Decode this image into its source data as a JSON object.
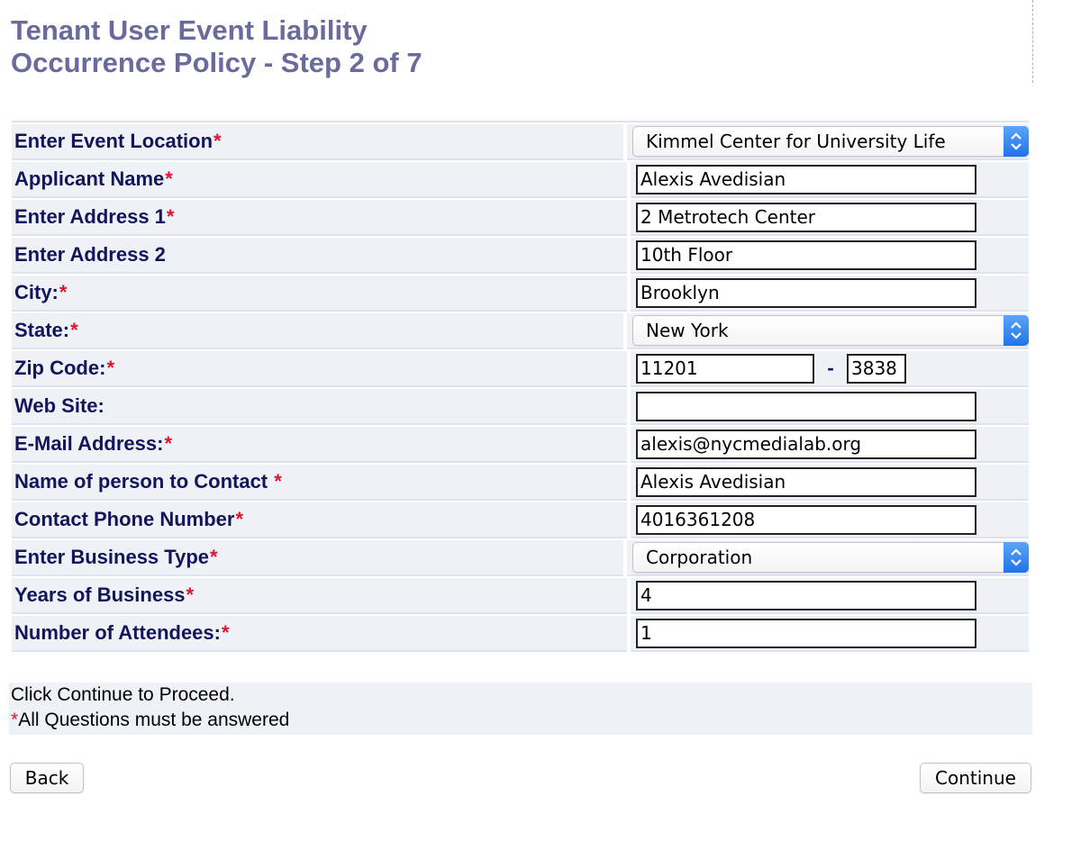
{
  "page": {
    "title_line1": "Tenant User Event Liability",
    "title_line2": "Occurrence Policy - Step 2 of 7"
  },
  "form": {
    "event_location": {
      "label": "Enter Event Location",
      "value": "Kimmel Center for University Life"
    },
    "applicant_name": {
      "label": "Applicant Name",
      "value": "Alexis Avedisian"
    },
    "address1": {
      "label": "Enter Address 1",
      "value": "2 Metrotech Center"
    },
    "address2": {
      "label": "Enter Address 2",
      "value": "10th Floor"
    },
    "city": {
      "label": "City:",
      "value": "Brooklyn"
    },
    "state": {
      "label": "State:",
      "value": "New York"
    },
    "zip": {
      "label": "Zip Code:",
      "value": "11201",
      "separator": "-",
      "plus4": "3838"
    },
    "website": {
      "label": "Web Site:",
      "value": ""
    },
    "email": {
      "label": "E-Mail Address:",
      "value": "alexis@nycmedialab.org"
    },
    "contact_name": {
      "label": "Name of person to Contact ",
      "value": "Alexis Avedisian"
    },
    "contact_phone": {
      "label": "Contact Phone Number",
      "value": "4016361208"
    },
    "business_type": {
      "label": "Enter Business Type",
      "value": "Corporation"
    },
    "years_business": {
      "label": "Years of Business",
      "value": "4"
    },
    "attendees": {
      "label": "Number of Attendees:",
      "value": "1"
    },
    "required_marker": "*"
  },
  "info": {
    "line1": "Click Continue to Proceed.",
    "line2": "All Questions must be answered"
  },
  "buttons": {
    "back": "Back",
    "continue": "Continue"
  },
  "colors": {
    "title": "#6a6a9c",
    "label": "#14145a",
    "required": "#e0142c",
    "row_bg": "#eef2f7",
    "select_arrow": "#1f73e8"
  }
}
